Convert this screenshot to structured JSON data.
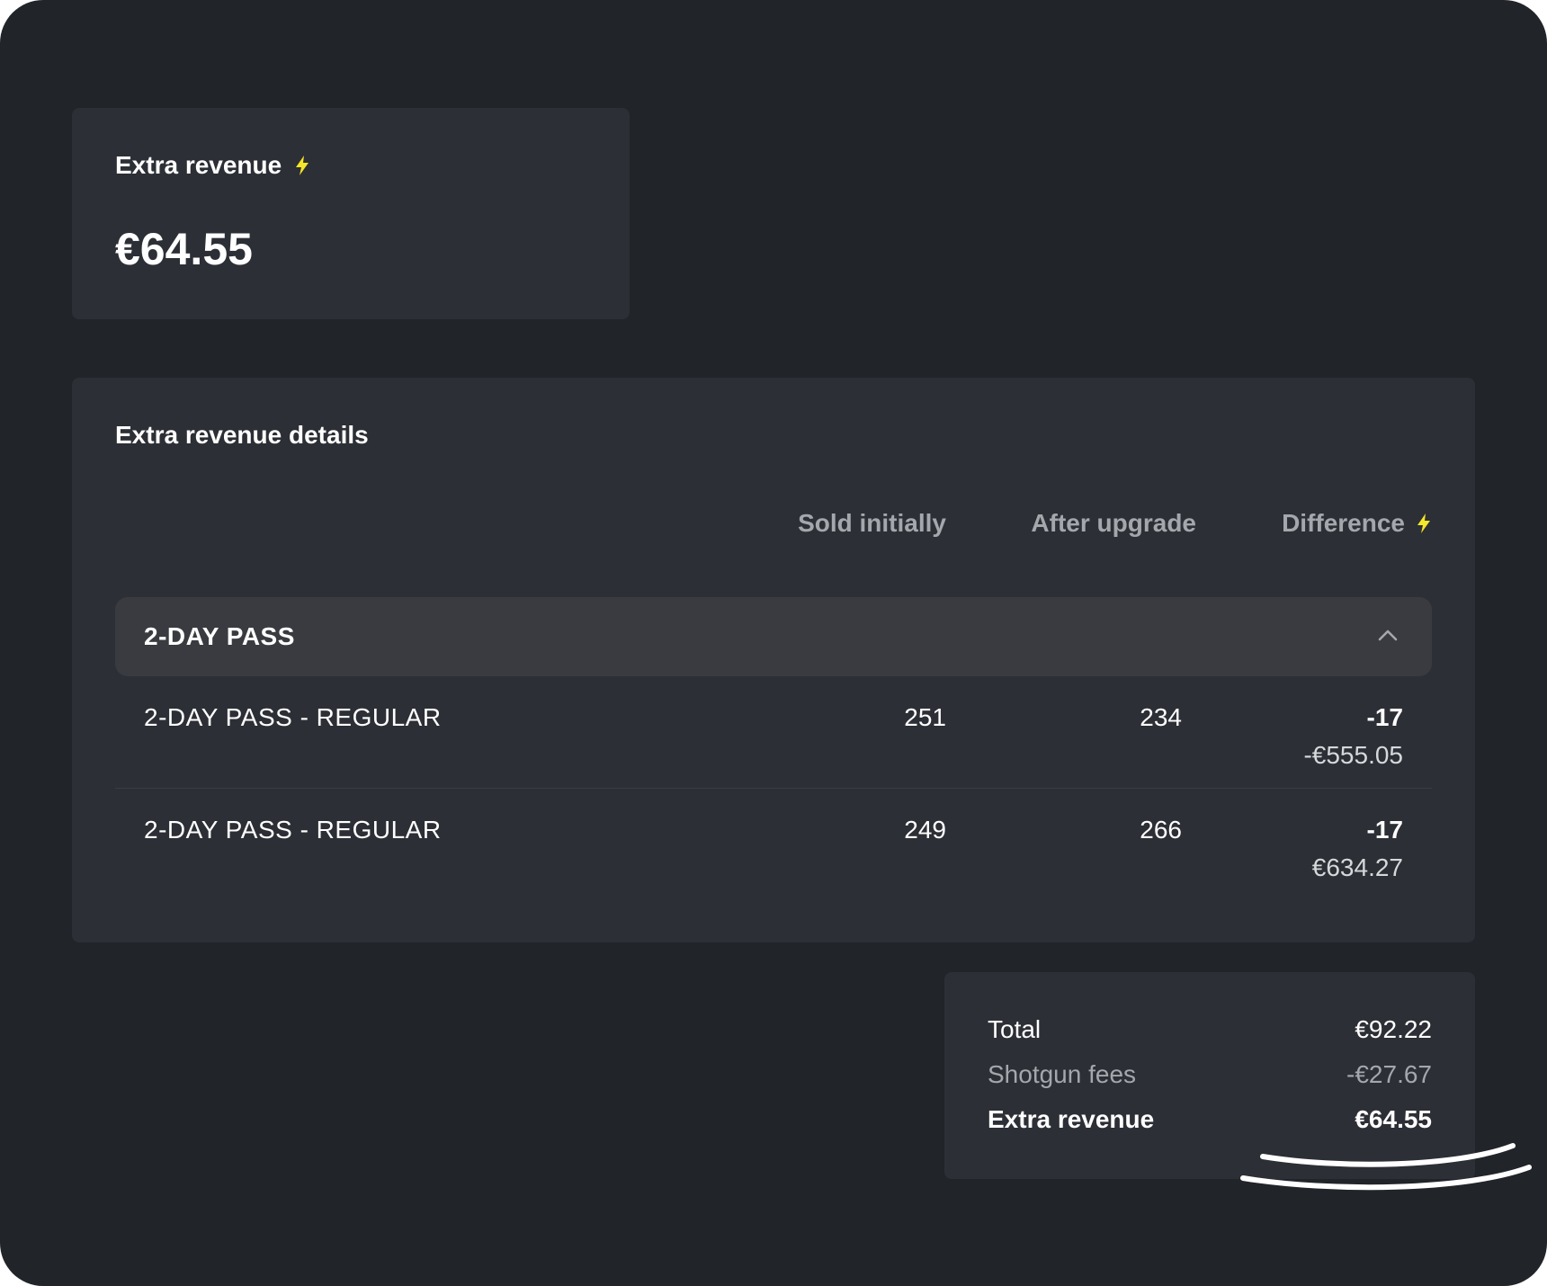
{
  "summary": {
    "label": "Extra revenue",
    "value": "€64.55",
    "icon": "lightning-bolt-icon"
  },
  "details": {
    "title": "Extra revenue details",
    "columns": {
      "sold_initially": "Sold initially",
      "after_upgrade": "After upgrade",
      "difference": "Difference"
    },
    "group": {
      "title": "2-DAY PASS",
      "expanded": true,
      "icon": "chevron-up-icon",
      "rows": [
        {
          "name": "2-DAY PASS - REGULAR",
          "sold_initially": "251",
          "after_upgrade": "234",
          "difference_count": "-17",
          "difference_amount": "-€555.05"
        },
        {
          "name": "2-DAY PASS - REGULAR",
          "sold_initially": "249",
          "after_upgrade": "266",
          "difference_count": "-17",
          "difference_amount": "€634.27"
        }
      ]
    }
  },
  "totals": {
    "total_label": "Total",
    "total_value": "€92.22",
    "fees_label": "Shotgun fees",
    "fees_value": "-€27.67",
    "extra_label": "Extra revenue",
    "extra_value": "€64.55"
  },
  "colors": {
    "background": "#212429",
    "card": "#2c2f35",
    "group_header": "#393b40",
    "accent_bolt": "#f5e62a",
    "text_primary": "#ffffff",
    "text_muted": "#a4a7ac"
  }
}
